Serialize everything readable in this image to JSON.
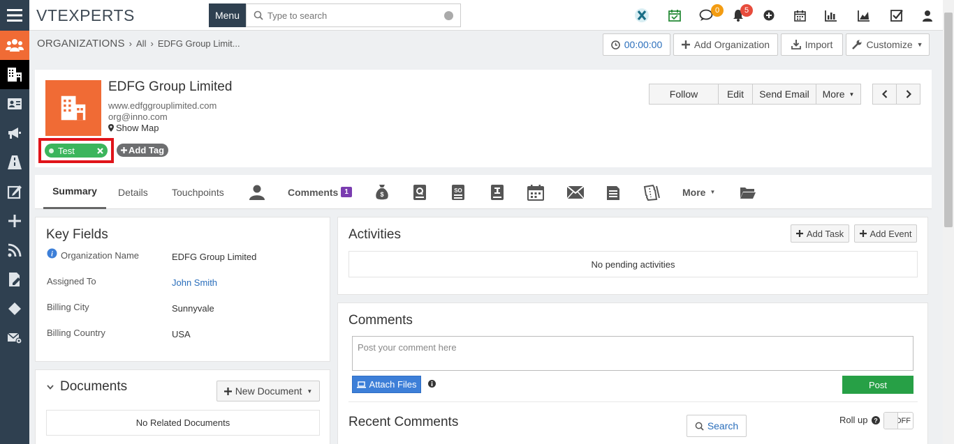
{
  "topbar": {
    "logo_text": "VTEXPERTS",
    "menu_label": "Menu",
    "search_placeholder": "Type to search",
    "comments_badge": "0",
    "notifications_badge": "5",
    "accent_badge_orange": "#f39c12",
    "accent_badge_red": "#e74c3c"
  },
  "breadcrumb": {
    "module": "ORGANIZATIONS",
    "filter": "All",
    "record": "EDFG Group Limit..."
  },
  "header_buttons": {
    "timer": "00:00:00",
    "add_org": "Add Organization",
    "import": "Import",
    "customize": "Customize"
  },
  "record": {
    "name": "EDFG Group Limited",
    "website": "www.edfggrouplimited.com",
    "email": "org@inno.com",
    "show_map": "Show Map",
    "tag": "Test",
    "add_tag": "Add Tag",
    "actions": {
      "follow": "Follow",
      "edit": "Edit",
      "send_email": "Send Email",
      "more": "More"
    }
  },
  "tabs": {
    "summary": "Summary",
    "details": "Details",
    "touchpoints": "Touchpoints",
    "comments": "Comments",
    "comments_count": "1",
    "more": "More",
    "icons": [
      "contact-icon",
      "money-bag-icon",
      "quote-icon",
      "sales-order-icon",
      "invoice-icon",
      "calendar-icon",
      "email-icon",
      "document-icon",
      "ticket-icon",
      "folder-icon"
    ]
  },
  "key_fields": {
    "title": "Key Fields",
    "rows": [
      {
        "label": "Organization Name",
        "value": "EDFG Group Limited"
      },
      {
        "label": "Assigned To",
        "value": "John Smith"
      },
      {
        "label": "Billing City",
        "value": "Sunnyvale"
      },
      {
        "label": "Billing Country",
        "value": "USA"
      }
    ]
  },
  "documents": {
    "title": "Documents",
    "new_button": "New Document",
    "empty": "No Related Documents"
  },
  "activities": {
    "title": "Activities",
    "add_task": "Add Task",
    "add_event": "Add Event",
    "empty": "No pending activities"
  },
  "comments_panel": {
    "title": "Comments",
    "placeholder": "Post your comment here",
    "attach": "Attach Files",
    "post": "Post",
    "recent_title": "Recent Comments",
    "search": "Search",
    "rollup_label": "Roll up",
    "toggle": "OFF"
  },
  "colors": {
    "sidebar": "#2f4050",
    "orange": "#f06b35",
    "tag_green": "#3bb55c",
    "post_green": "#27a046",
    "attach_blue": "#3d7fd8",
    "highlight_red": "#e0141a",
    "link_blue": "#2a6ebb"
  }
}
